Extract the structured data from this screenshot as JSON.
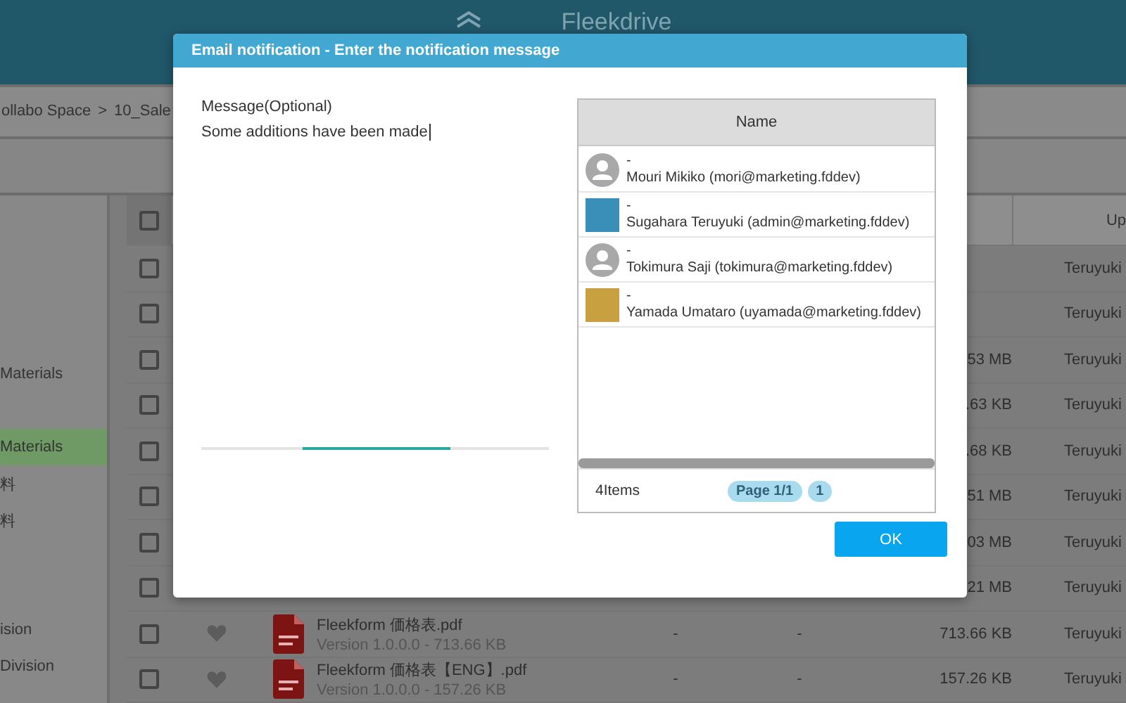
{
  "header": {
    "logo": "Fleekdrive"
  },
  "breadcrumb": {
    "items": [
      "ollabo Space",
      "10_Sale"
    ],
    "separator": ">"
  },
  "sidebar": {
    "items": [
      {
        "label": "Materials",
        "selected": false
      },
      {
        "label": "Materials",
        "selected": true
      },
      {
        "label": "料",
        "selected": false
      },
      {
        "label": "料",
        "selected": false
      },
      {
        "label": "ision",
        "selected": false
      },
      {
        "label": "Division",
        "selected": false
      }
    ]
  },
  "table": {
    "select_all_checked": false,
    "columns": [
      {
        "label": "Up"
      }
    ],
    "rows": [
      {
        "checked": false,
        "user": "Teruyuki"
      },
      {
        "checked": false,
        "user": "Teruyuki"
      },
      {
        "checked": false,
        "size": "53 MB",
        "user": "Teruyuki"
      },
      {
        "checked": false,
        "size": ".63 KB",
        "user": "Teruyuki"
      },
      {
        "checked": false,
        "size": ".68 KB",
        "user": "Teruyuki"
      },
      {
        "checked": false,
        "size": "51 MB",
        "user": "Teruyuki"
      },
      {
        "checked": false,
        "size": "03 MB",
        "user": "Teruyuki"
      },
      {
        "checked": false,
        "size": "21 MB",
        "user": "Teruyuki"
      },
      {
        "checked": false,
        "name": "Fleekform 価格表.pdf",
        "version": "Version 1.0.0.0 - 713.66 KB",
        "column_5": "-",
        "column_6": "-",
        "size": "713.66 KB",
        "user": "Teruyuki"
      },
      {
        "checked": false,
        "name": "Fleekform 価格表【ENG】.pdf",
        "version": "Version 1.0.0.0 - 157.26 KB",
        "column_5": "-",
        "column_6": "-",
        "size": "157.26 KB",
        "user": "Teruyuki"
      }
    ]
  },
  "dialog": {
    "title": "Email notification - Enter the notification message",
    "message": {
      "label": "Message(Optional)",
      "value": "Some additions have been made"
    },
    "recipients": {
      "column": "Name",
      "rows": [
        {
          "kind": "default",
          "line_1": "-",
          "name": "Mouri Mikiko (mori@marketing.fddev)"
        },
        {
          "kind": "photo",
          "line_1": "-",
          "name": "Sugahara Teruyuki (admin@marketing.fddev)"
        },
        {
          "kind": "default",
          "line_1": "-",
          "name": "Tokimura Saji (tokimura@marketing.fddev)"
        },
        {
          "kind": "photo",
          "line_1": "-",
          "name": "Yamada Umataro (uyamada@marketing.fddev)"
        }
      ],
      "count": "4Items",
      "page": "Page 1/1",
      "pages": [
        "1"
      ]
    },
    "ok": "OK"
  }
}
